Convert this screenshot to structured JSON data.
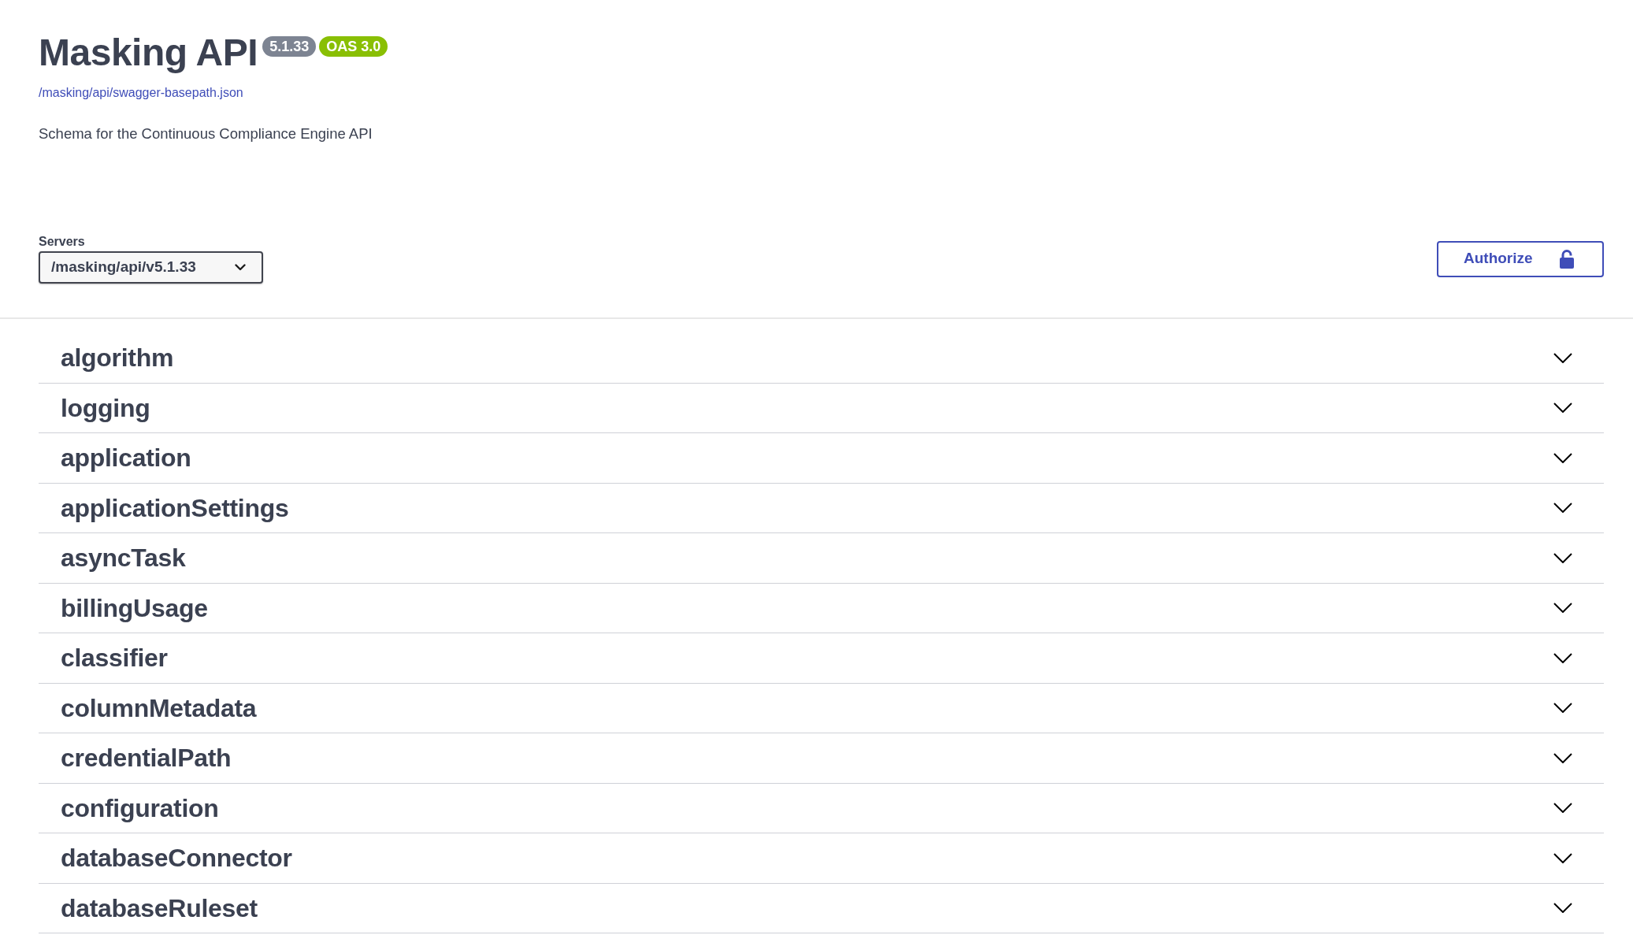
{
  "title": "Masking API",
  "badges": [
    {
      "text": "5.1.33",
      "kind": "version"
    },
    {
      "text": "OAS 3.0",
      "kind": "oas"
    }
  ],
  "spec_link": "/masking/api/swagger-basepath.json",
  "description": "Schema for the Continuous Compliance Engine API",
  "servers": {
    "label": "Servers",
    "value": "/masking/api/v5.1.33"
  },
  "authorize_button": {
    "label": "Authorize"
  },
  "tags": [
    {
      "name": "algorithm",
      "expanded": false
    },
    {
      "name": "logging",
      "expanded": false
    },
    {
      "name": "application",
      "expanded": false
    },
    {
      "name": "applicationSettings",
      "expanded": false
    },
    {
      "name": "asyncTask",
      "expanded": false
    },
    {
      "name": "billingUsage",
      "expanded": false
    },
    {
      "name": "classifier",
      "expanded": false
    },
    {
      "name": "columnMetadata",
      "expanded": false
    },
    {
      "name": "credentialPath",
      "expanded": false
    },
    {
      "name": "configuration",
      "expanded": false
    },
    {
      "name": "databaseConnector",
      "expanded": false
    },
    {
      "name": "databaseRuleset",
      "expanded": false
    }
  ]
}
